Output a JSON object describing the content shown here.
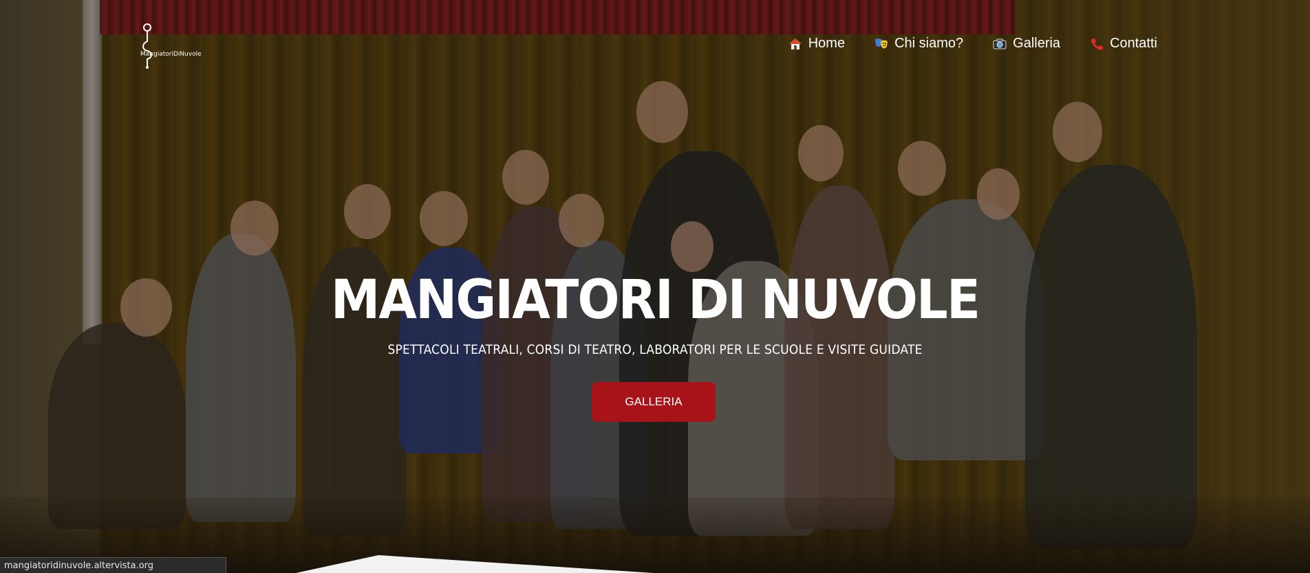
{
  "logo": {
    "text": "MangiatoriDiNuvole"
  },
  "nav": {
    "items": [
      {
        "label": "Home",
        "icon": "house-icon"
      },
      {
        "label": "Chi siamo?",
        "icon": "theater-masks-icon"
      },
      {
        "label": "Galleria",
        "icon": "camera-icon"
      },
      {
        "label": "Contatti",
        "icon": "telephone-icon"
      }
    ]
  },
  "hero": {
    "title": "MANGIATORI DI NUVOLE",
    "subtitle": "SPETTACOLI TEATRALI, CORSI DI TEATRO, LABORATORI PER LE SCUOLE E VISITE GUIDATE",
    "cta_label": "GALLERIA"
  },
  "status_bar": {
    "url": "mangiatoridinuvole.altervista.org"
  },
  "colors": {
    "cta_background": "#a8131a",
    "text": "#ffffff"
  }
}
